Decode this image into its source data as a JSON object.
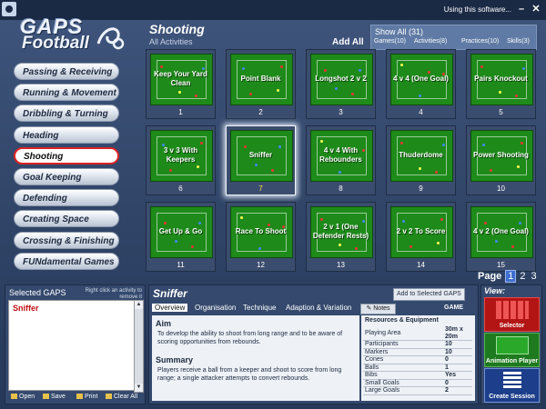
{
  "window": {
    "title": "Using this software...",
    "minimize": "–",
    "close": "✕"
  },
  "logo": {
    "line1": "GAPS",
    "line2": "Football"
  },
  "categories": [
    "Passing & Receiving",
    "Running & Movement",
    "Dribbling & Turning",
    "Heading",
    "Shooting",
    "Goal Keeping",
    "Defending",
    "Creating Space",
    "Crossing & Finishing",
    "FUNdamental Games"
  ],
  "active_category": "Shooting",
  "header": {
    "title": "Shooting",
    "subtitle": "All Activities",
    "add_all": "Add All",
    "show_all": "Show All (31)",
    "filters": [
      "Games(10)",
      "Activities(8)",
      "Practices(10)",
      "Skills(3)"
    ]
  },
  "activities": [
    {
      "name": "Keep Your Yard Clean",
      "num": "1"
    },
    {
      "name": "Point Blank",
      "num": "2"
    },
    {
      "name": "Longshot 2 v 2",
      "num": "3"
    },
    {
      "name": "4 v 4 (One Goal)",
      "num": "4"
    },
    {
      "name": "Pairs Knockout",
      "num": "5"
    },
    {
      "name": "3 v 3 With Keepers",
      "num": "6"
    },
    {
      "name": "Sniffer",
      "num": "7"
    },
    {
      "name": "4 v 4 With Rebounders",
      "num": "8"
    },
    {
      "name": "Thuderdome",
      "num": "9"
    },
    {
      "name": "Power Shooting",
      "num": "10"
    },
    {
      "name": "Get Up & Go",
      "num": "11"
    },
    {
      "name": "Race To Shoot",
      "num": "12"
    },
    {
      "name": "2 v 1 (One Defender Rests)",
      "num": "13"
    },
    {
      "name": "2 v 2 To Score",
      "num": "14"
    },
    {
      "name": "4 v 2 (One Goal)",
      "num": "15"
    }
  ],
  "highlighted_activity": "Sniffer",
  "pager": {
    "label": "Page",
    "pages": [
      "1",
      "2",
      "3"
    ],
    "current": "1"
  },
  "selected": {
    "title": "Selected GAPS",
    "hint": "Right click an activity to remove it",
    "items": [
      "Sniffer"
    ],
    "actions": [
      "Open",
      "Save",
      "Print",
      "Clear All"
    ]
  },
  "detail": {
    "title": "Sniffer",
    "add_button": "Add to Selected GAPS",
    "tabs": [
      "Overview",
      "Organisation",
      "Technique",
      "Adaption & Variation"
    ],
    "active_tab": "Overview",
    "notes": "Notes",
    "type": "GAME",
    "aim_heading": "Aim",
    "aim_text": "To develop the ability to shoot from long range and to be aware of scoring opportunities from rebounds.",
    "summary_heading": "Summary",
    "summary_text": "Players receive a ball from a keeper and shoot to score from long range; a single attacker attempts to convert rebounds.",
    "resources_heading": "Resources & Equipment",
    "resources": [
      {
        "label": "Playing Area",
        "value": "30m x 20m"
      },
      {
        "label": "Participants",
        "value": "10"
      },
      {
        "label": "Markers",
        "value": "10"
      },
      {
        "label": "Cones",
        "value": "0"
      },
      {
        "label": "Balls",
        "value": "1"
      },
      {
        "label": "Bibs",
        "value": "Yes"
      },
      {
        "label": "Small Goals",
        "value": "0"
      },
      {
        "label": "Large Goals",
        "value": "2"
      }
    ]
  },
  "view": {
    "title": "View:",
    "buttons": [
      "Selector",
      "Animation Player",
      "Create Session"
    ]
  },
  "colors": {
    "pitch": "#1e8a1a",
    "active_border": "#dd2222",
    "selected_item": "#c01010",
    "highlight_num": "#ffe63a"
  }
}
